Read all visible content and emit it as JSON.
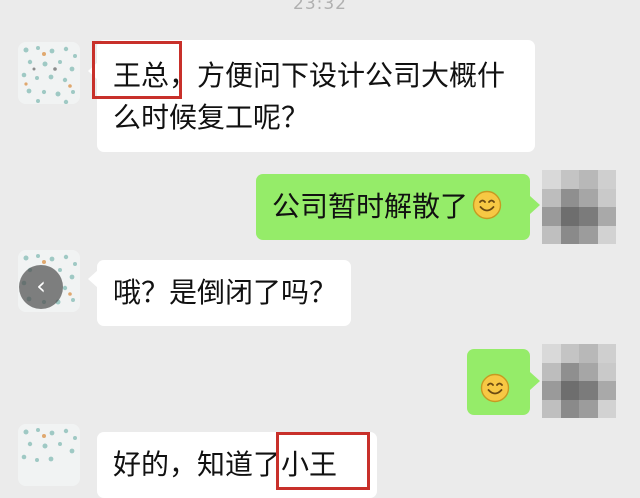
{
  "header": {
    "time": "23:32"
  },
  "messages": [
    {
      "side": "left",
      "text": "王总，方便问下设计公司大概什么时候复工呢？",
      "line1": "王总，方便问下设计公司大概什",
      "line2": "么时候复工呢？"
    },
    {
      "side": "right",
      "text": "公司暂时解散了",
      "emoji": "smile-emoji"
    },
    {
      "side": "left",
      "text": "哦？是倒闭了吗？"
    },
    {
      "side": "right",
      "text": "",
      "emoji": "smile-emoji"
    },
    {
      "side": "left",
      "text": "好的，知道了小王"
    }
  ],
  "nav": {
    "back_glyph": "‹"
  },
  "colors": {
    "background": "#ebebeb",
    "incoming_bubble": "#ffffff",
    "outgoing_bubble": "#95ec69",
    "highlight": "#c8302a"
  }
}
